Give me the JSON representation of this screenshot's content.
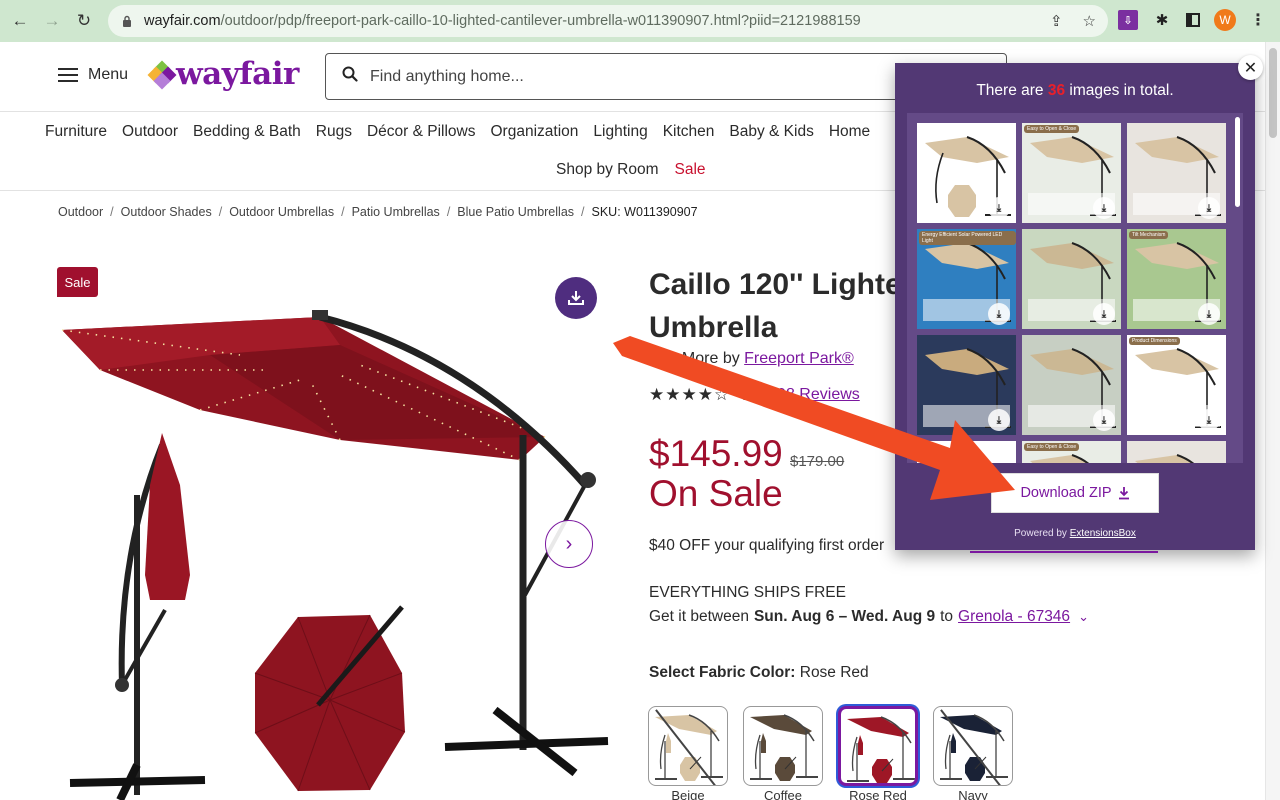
{
  "browser": {
    "url_domain": "wayfair.com",
    "url_path": "/outdoor/pdp/freeport-park-caillo-10-lighted-cantilever-umbrella-w011390907.html?piid=2121988159",
    "back_icon": "arrow-left",
    "forward_icon": "arrow-right",
    "reload_icon": "reload",
    "profile_initial": "W",
    "profile_color": "#f07a1a"
  },
  "header": {
    "menu_label": "Menu",
    "logo_text": "wayfair",
    "search_placeholder": "Find anything home..."
  },
  "categories": {
    "row1": [
      "Furniture",
      "Outdoor",
      "Bedding & Bath",
      "Rugs",
      "Décor & Pillows",
      "Organization",
      "Lighting",
      "Kitchen",
      "Baby & Kids",
      "Home"
    ],
    "row2": [
      "Shop by Room",
      "Sale"
    ]
  },
  "breadcrumb": {
    "items": [
      "Outdoor",
      "Outdoor Shades",
      "Outdoor Umbrellas",
      "Patio Umbrellas",
      "Blue Patio Umbrellas"
    ],
    "sku": "SKU: W011390907"
  },
  "gallery": {
    "sale_badge": "Sale"
  },
  "product": {
    "title_line1": "Caillo 120'' Lighte",
    "title_line2": "Umbrella",
    "see_more_prefix": "See More by ",
    "brand": "Freeport Park®",
    "rating": "4.4",
    "rating_value": 4.4,
    "reviews": "98 Reviews",
    "price": "$145.99",
    "old_price": "$179.00",
    "sale_text": "On Sale",
    "promo": "$40 OFF your qualifying first order",
    "ships": "EVERYTHING SHIPS FREE",
    "delivery_prefix": "Get it between ",
    "delivery_dates": "Sun. Aug 6 – Wed. Aug 9",
    "delivery_to": " to ",
    "delivery_location": "Grenola - 67346",
    "fabric_label": "Select Fabric Color:",
    "fabric_value": " Rose Red",
    "swatches": [
      {
        "name": "Beige",
        "color": "#d8c4a4",
        "selected": false,
        "unavailable": true
      },
      {
        "name": "Coffee",
        "color": "#5a4a3a",
        "selected": false,
        "unavailable": false
      },
      {
        "name": "Rose Red",
        "color": "#9e1726",
        "selected": true,
        "unavailable": false
      },
      {
        "name": "Navy",
        "color": "#1a2236",
        "selected": false,
        "unavailable": true
      }
    ]
  },
  "popup": {
    "title_prefix": "There are ",
    "count": "36",
    "title_suffix": " images in total.",
    "download_label": "Download ZIP",
    "powered_prefix": "Powered by ",
    "powered_link": "ExtensionsBox",
    "thumbnails": [
      {
        "kind": "product",
        "badge": ""
      },
      {
        "kind": "lifestyle",
        "badge": "Easy to Open & Close"
      },
      {
        "kind": "details",
        "badge": ""
      },
      {
        "kind": "blue",
        "badge": "Energy Efficient Solar Powered LED Light"
      },
      {
        "kind": "garden",
        "badge": ""
      },
      {
        "kind": "tilt",
        "badge": "Tilt Mechanism"
      },
      {
        "kind": "night",
        "badge": ""
      },
      {
        "kind": "patio",
        "badge": ""
      },
      {
        "kind": "dimensions",
        "badge": "Product Dimensions"
      },
      {
        "kind": "product-brown",
        "badge": ""
      },
      {
        "kind": "lifestyle",
        "badge": "Easy to Open & Close"
      },
      {
        "kind": "details",
        "badge": ""
      }
    ]
  },
  "colors": {
    "brand_purple": "#7b189f",
    "popup_bg": "#523874",
    "sale_red": "#a0102e",
    "arrow": "#f04b23"
  }
}
